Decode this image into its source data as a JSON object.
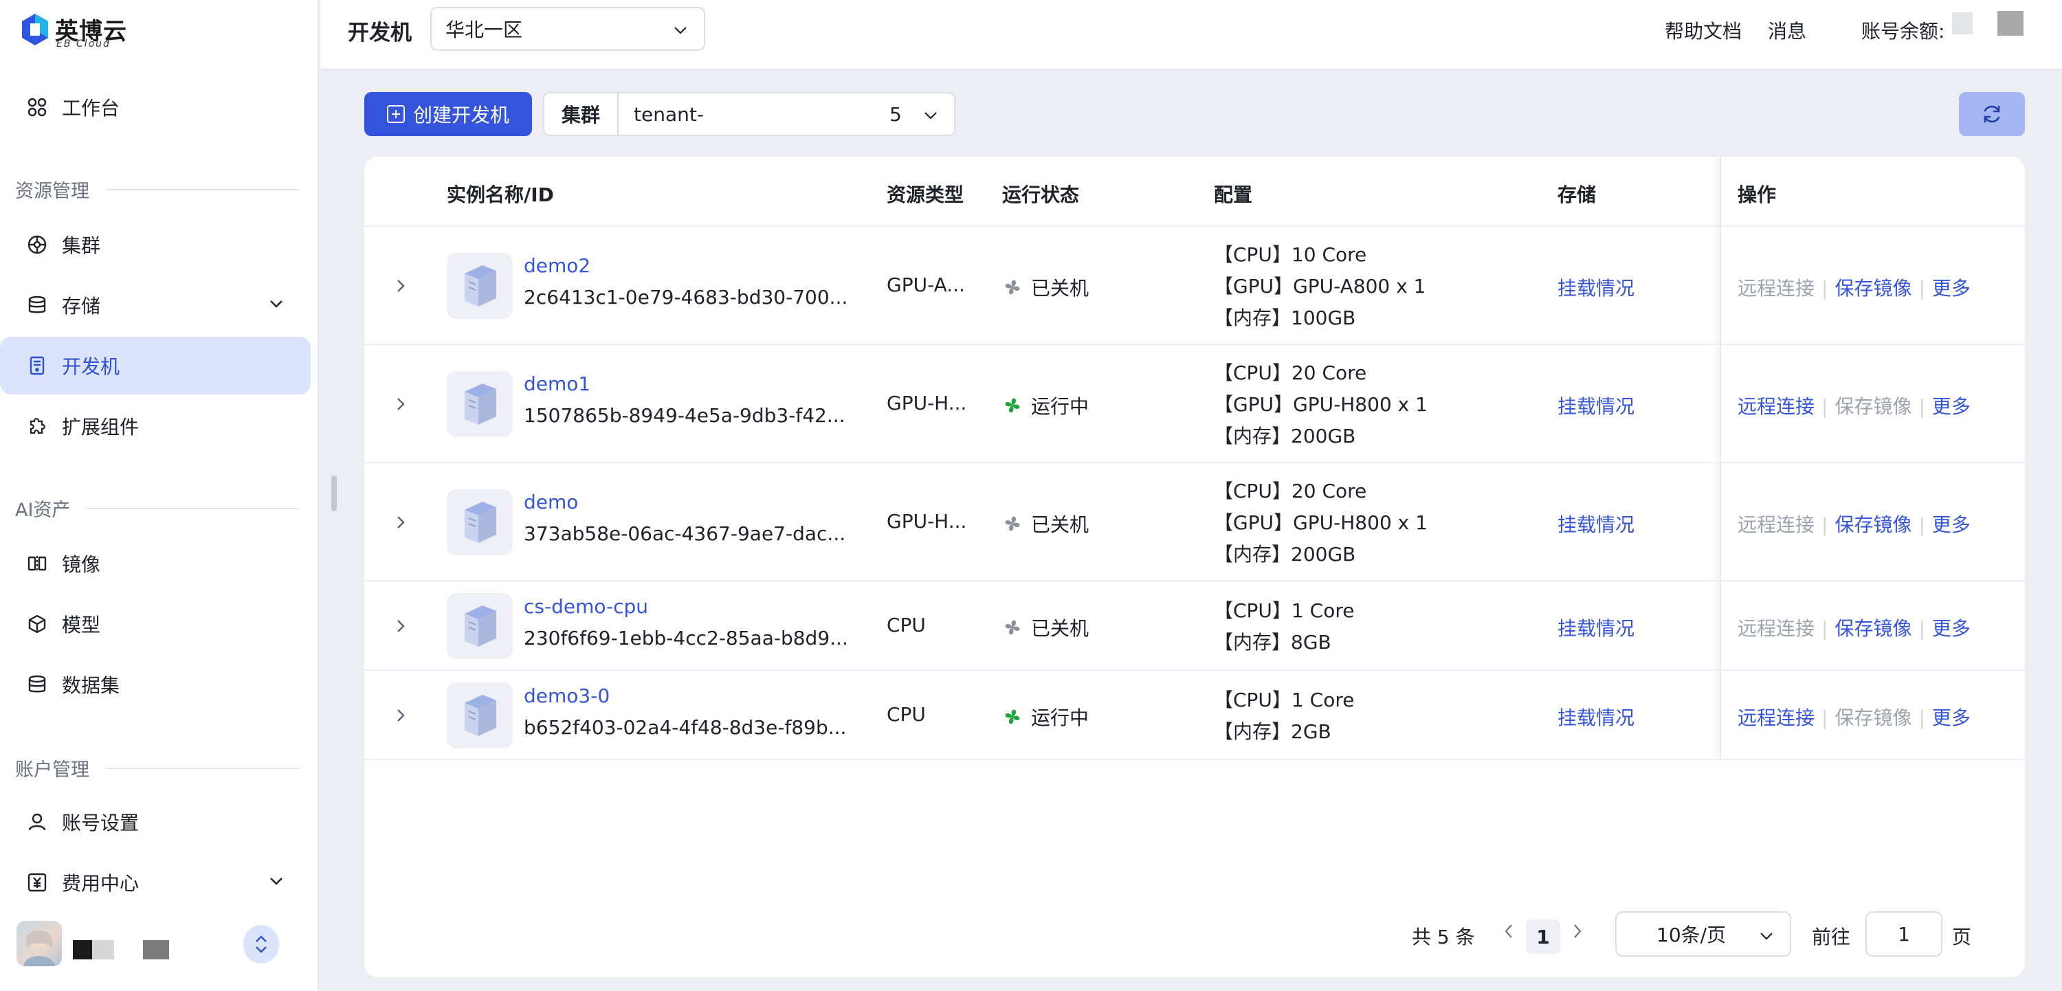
{
  "brand": {
    "name": "英博云",
    "sub": "EB Cloud"
  },
  "sidebar": {
    "workbench": "工作台",
    "sections": [
      {
        "label": "资源管理"
      },
      {
        "label": "AI资产"
      },
      {
        "label": "账户管理"
      }
    ],
    "items": [
      {
        "label": "集群",
        "icon": "cluster-icon"
      },
      {
        "label": "存储",
        "icon": "database-icon"
      },
      {
        "label": "开发机",
        "icon": "devbox-icon"
      },
      {
        "label": "扩展组件",
        "icon": "puzzle-icon"
      },
      {
        "label": "镜像",
        "icon": "mirror-icon"
      },
      {
        "label": "模型",
        "icon": "cube-icon"
      },
      {
        "label": "数据集",
        "icon": "database-icon"
      },
      {
        "label": "账号设置",
        "icon": "user-icon"
      },
      {
        "label": "费用中心",
        "icon": "yen-icon"
      }
    ],
    "active_index": 2
  },
  "header": {
    "title": "开发机",
    "region": "华北一区",
    "help": "帮助文档",
    "messages": "消息",
    "balance_label": "账号余额:"
  },
  "toolbar": {
    "create_label": "创建开发机",
    "cluster_label": "集群",
    "cluster_value_prefix": "tenant-",
    "cluster_value_suffix": "5"
  },
  "table": {
    "columns": [
      "实例名称/ID",
      "资源类型",
      "运行状态",
      "配置",
      "存储",
      "操作"
    ],
    "rows": [
      {
        "name": "demo2",
        "id": "2c6413c1-0e79-4683-bd30-700...",
        "type": "GPU-A...",
        "status": "已关机",
        "running": false,
        "config": [
          "【CPU】10 Core",
          "【GPU】GPU-A800 x 1",
          "【内存】100GB"
        ],
        "storage": "挂载情况"
      },
      {
        "name": "demo1",
        "id": "1507865b-8949-4e5a-9db3-f42...",
        "type": "GPU-H...",
        "status": "运行中",
        "running": true,
        "config": [
          "【CPU】20 Core",
          "【GPU】GPU-H800 x 1",
          "【内存】200GB"
        ],
        "storage": "挂载情况"
      },
      {
        "name": "demo",
        "id": "373ab58e-06ac-4367-9ae7-dac...",
        "type": "GPU-H...",
        "status": "已关机",
        "running": false,
        "config": [
          "【CPU】20 Core",
          "【GPU】GPU-H800 x 1",
          "【内存】200GB"
        ],
        "storage": "挂载情况"
      },
      {
        "name": "cs-demo-cpu",
        "id": "230f6f69-1ebb-4cc2-85aa-b8d9...",
        "type": "CPU",
        "status": "已关机",
        "running": false,
        "config": [
          "【CPU】1 Core",
          "【内存】8GB"
        ],
        "storage": "挂载情况"
      },
      {
        "name": "demo3-0",
        "id": "b652f403-02a4-4f48-8d3e-f89b...",
        "type": "CPU",
        "status": "运行中",
        "running": true,
        "config": [
          "【CPU】1 Core",
          "【内存】2GB"
        ],
        "storage": "挂载情况"
      }
    ],
    "actions": {
      "remote": "远程连接",
      "save_image": "保存镜像",
      "more": "更多"
    }
  },
  "pagination": {
    "total": "共 5 条",
    "current_page": "1",
    "page_size": "10条/页",
    "goto_label": "前往",
    "goto_value": "1",
    "page_suffix": "页"
  },
  "colors": {
    "accent": "#3455db",
    "active_bg": "#dbe4fb",
    "running": "#22a33a",
    "stopped": "#8a8f99"
  }
}
